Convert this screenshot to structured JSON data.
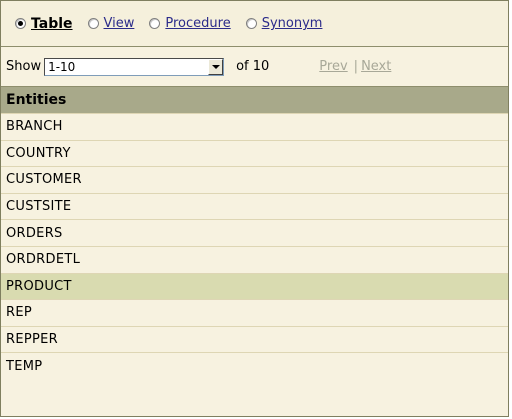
{
  "object_types": [
    {
      "label": "Table",
      "selected": true
    },
    {
      "label": "View",
      "selected": false
    },
    {
      "label": "Procedure",
      "selected": false
    },
    {
      "label": "Synonym",
      "selected": false
    }
  ],
  "pager": {
    "show_label": "Show",
    "range_value": "1-10",
    "of_text": "of 10",
    "prev_label": "Prev",
    "separator": "|",
    "next_label": "Next"
  },
  "table": {
    "header": "Entities",
    "rows": [
      "BRANCH",
      "COUNTRY",
      "CUSTOMER",
      "CUSTSITE",
      "ORDERS",
      "ORDRDETL",
      "PRODUCT",
      "REP",
      "REPPER",
      "TEMP"
    ],
    "selected_row": "PRODUCT"
  }
}
